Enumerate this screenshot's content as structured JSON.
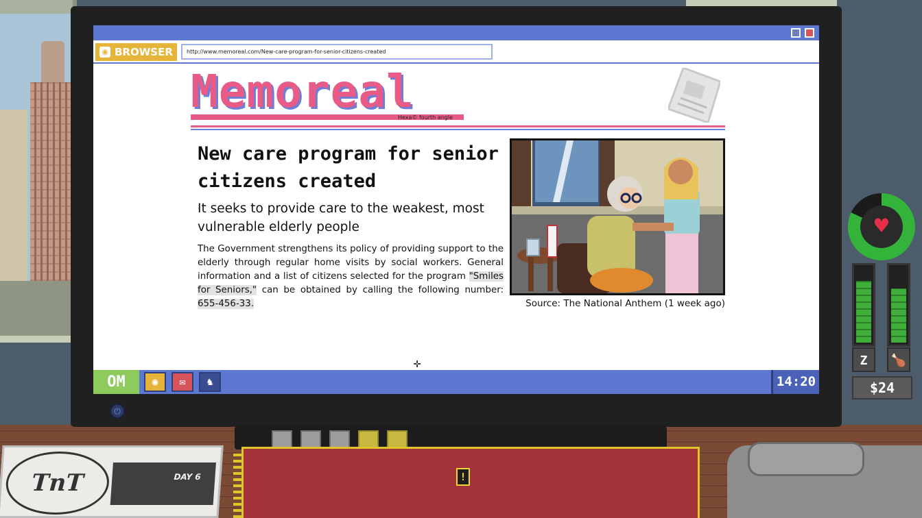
{
  "browser": {
    "tag_label": "BROWSER",
    "url": "http://www.memoreal.com/New-care-program-for-senior-citizens-created"
  },
  "site": {
    "logo": "Memoreal",
    "logo_sub": "Hexa© fourth angle"
  },
  "article": {
    "headline": "New care program for senior citizens created",
    "subhead": "It seeks to provide care to the weakest, most vulnerable elderly people",
    "body_before": "The Government strengthens its policy of providing support to the elderly through regular home visits by social workers. General information and a list of citizens selected for the program ",
    "program_name": "\"Smiles for Seniors,\"",
    "body_middle": " can be obtained by calling the following number: ",
    "phone": "655-456-33.",
    "caption": "Source: The National Anthem (1 week ago)"
  },
  "taskbar": {
    "start_label": "OM",
    "clock": "14:20"
  },
  "hud": {
    "health_fraction": 0.82,
    "sleep_level": 0.82,
    "food_level": 0.72,
    "money": "$24"
  },
  "desk": {
    "newspaper_logo": "TnT",
    "day_label": "DAY 6",
    "notebook_alert": "!"
  },
  "colors": {
    "accent_blue": "#5d78d0",
    "logo_pink": "#e85b86",
    "browser_yellow": "#e7b43a",
    "start_green": "#8dcb5c"
  },
  "icons": {
    "browser": "browser-icon",
    "mail": "mail-icon",
    "tt": "tnt-app-icon",
    "heart": "heart-icon",
    "sleep": "sleep-icon",
    "food": "food-icon"
  }
}
